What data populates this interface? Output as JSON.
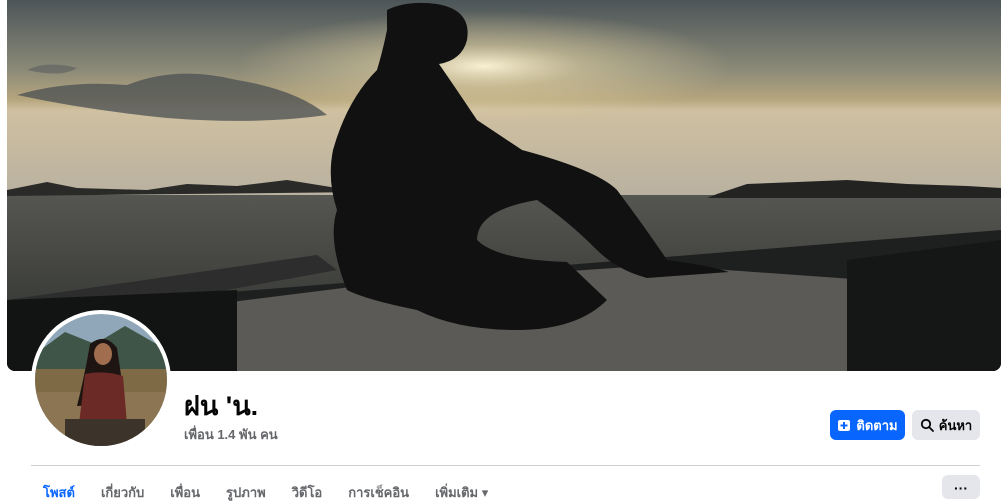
{
  "profile": {
    "name": "ฝน 'น.",
    "friends_text": "เพื่อน 1.4 พัน คน"
  },
  "actions": {
    "follow_label": "ติดตาม",
    "search_label": "ค้นหา"
  },
  "tabs": [
    {
      "label": "โพสต์",
      "active": true
    },
    {
      "label": "เกี่ยวกับ"
    },
    {
      "label": "เพื่อน"
    },
    {
      "label": "รูปภาพ"
    },
    {
      "label": "วิดีโอ"
    },
    {
      "label": "การเช็คอิน"
    },
    {
      "label": "เพิ่มเติม ▾"
    }
  ],
  "more_label": "···",
  "colors": {
    "accent": "#0866ff",
    "secondary_button": "#e4e6eb",
    "muted_text": "#65676b"
  },
  "icons": {
    "follow": "follow-plus-icon",
    "search": "search-icon"
  }
}
